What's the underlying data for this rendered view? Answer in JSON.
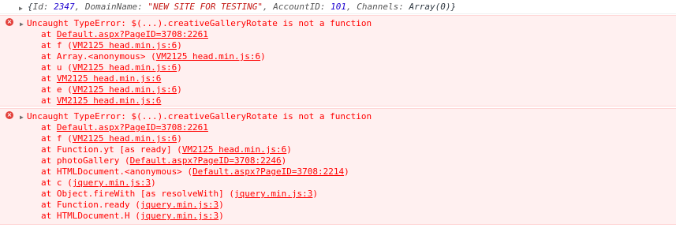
{
  "object_log": {
    "open": "{",
    "id_key": "Id: ",
    "id_val": "2347",
    "domain_key": ", DomainName: ",
    "domain_val": "\"NEW SITE FOR TESTING\"",
    "account_key": ", AccountID: ",
    "account_val": "101",
    "channels_key": ", Channels: ",
    "channels_val": "Array(0)",
    "close": "}"
  },
  "errors": [
    {
      "icon": "error-icon",
      "message": "Uncaught TypeError: $(...).creativeGalleryRotate is not a function",
      "frames": [
        {
          "prefix": "at ",
          "link": "Default.aspx?PageID=3708:2261",
          "suffix": ""
        },
        {
          "prefix": "at f (",
          "link": "VM2125 head.min.js:6",
          "suffix": ")"
        },
        {
          "prefix": "at Array.<anonymous> (",
          "link": "VM2125 head.min.js:6",
          "suffix": ")"
        },
        {
          "prefix": "at u (",
          "link": "VM2125 head.min.js:6",
          "suffix": ")"
        },
        {
          "prefix": "at ",
          "link": "VM2125 head.min.js:6",
          "suffix": ""
        },
        {
          "prefix": "at e (",
          "link": "VM2125 head.min.js:6",
          "suffix": ")"
        },
        {
          "prefix": "at ",
          "link": "VM2125 head.min.js:6",
          "suffix": ""
        }
      ]
    },
    {
      "icon": "error-icon",
      "message": "Uncaught TypeError: $(...).creativeGalleryRotate is not a function",
      "frames": [
        {
          "prefix": "at ",
          "link": "Default.aspx?PageID=3708:2261",
          "suffix": ""
        },
        {
          "prefix": "at f (",
          "link": "VM2125 head.min.js:6",
          "suffix": ")"
        },
        {
          "prefix": "at Function.yt [as ready] (",
          "link": "VM2125 head.min.js:6",
          "suffix": ")"
        },
        {
          "prefix": "at photoGallery (",
          "link": "Default.aspx?PageID=3708:2246",
          "suffix": ")"
        },
        {
          "prefix": "at HTMLDocument.<anonymous> (",
          "link": "Default.aspx?PageID=3708:2214",
          "suffix": ")"
        },
        {
          "prefix": "at c (",
          "link": "jquery.min.js:3",
          "suffix": ")"
        },
        {
          "prefix": "at Object.fireWith [as resolveWith] (",
          "link": "jquery.min.js:3",
          "suffix": ")"
        },
        {
          "prefix": "at Function.ready (",
          "link": "jquery.min.js:3",
          "suffix": ")"
        },
        {
          "prefix": "at HTMLDocument.H (",
          "link": "jquery.min.js:3",
          "suffix": ")"
        }
      ]
    }
  ],
  "colors": {
    "error_text": "#ff0000",
    "error_bg": "#fff0f0",
    "error_border": "#ffd6d6",
    "string": "#c41a16",
    "number": "#1c00cf"
  }
}
